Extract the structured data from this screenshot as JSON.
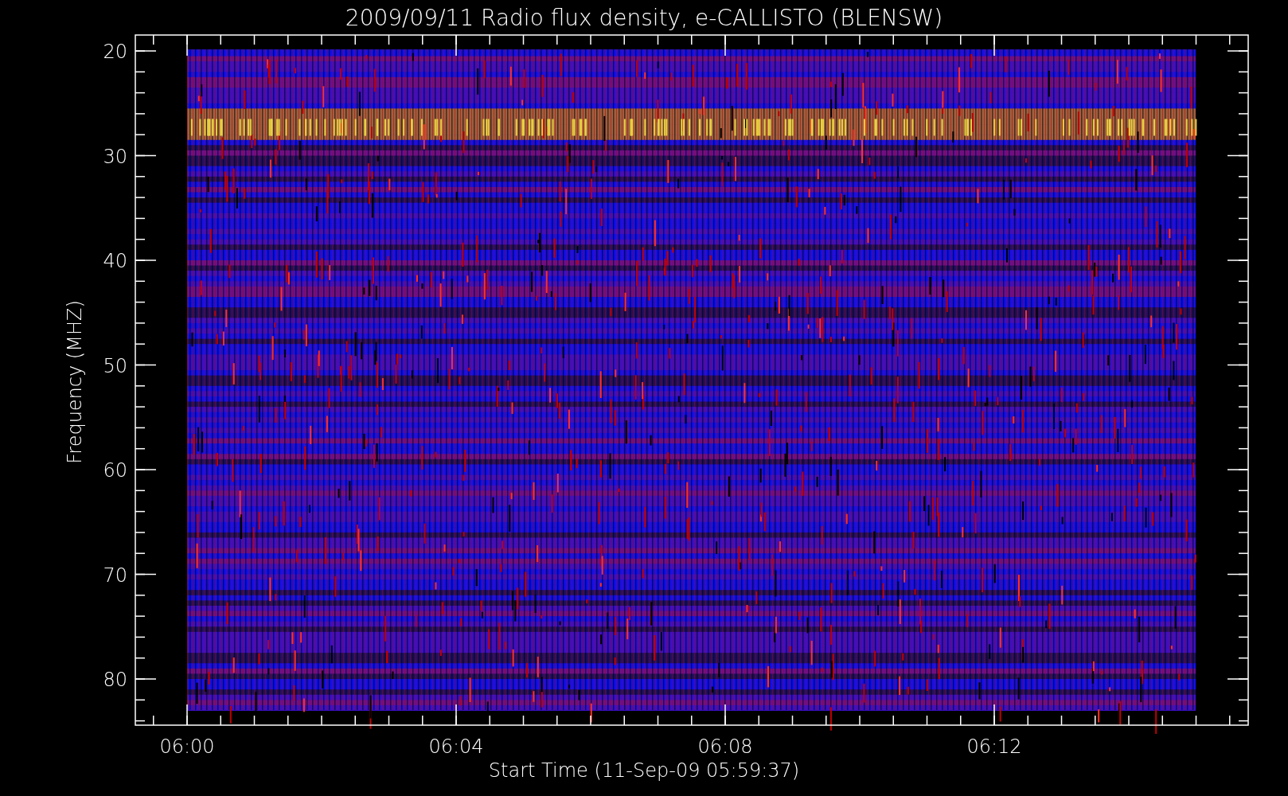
{
  "plot": {
    "title": "2009/09/11  Radio flux density, e-CALLISTO (BLENSW)",
    "ylabel": "Frequency (MHZ)",
    "xlabel": "Start Time (11-Sep-09 05:59:37)",
    "yticks": [
      "20",
      "30",
      "40",
      "50",
      "60",
      "70",
      "80"
    ],
    "xticks": [
      "06:00",
      "06:04",
      "06:08",
      "06:12"
    ]
  }
}
